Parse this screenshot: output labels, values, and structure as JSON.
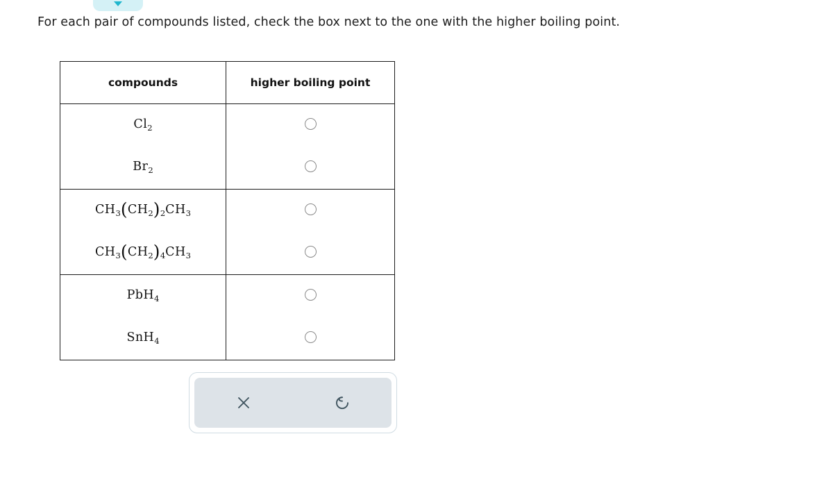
{
  "top_chip": {
    "icon": "chevron-down-icon",
    "background_color": "#d4f1f6",
    "chevron_color": "#1fb6cd"
  },
  "instruction": "For each pair of compounds listed, check the box next to the one with the higher boiling point.",
  "table": {
    "headers": {
      "compounds": "compounds",
      "higher_boiling_point": "higher boiling point"
    },
    "groups": [
      {
        "rows": [
          {
            "formula_plain": "Cl2",
            "parts": {
              "pre": "Cl",
              "pre_sub": "2"
            },
            "selected": false
          },
          {
            "formula_plain": "Br2",
            "parts": {
              "pre": "Br",
              "pre_sub": "2"
            },
            "selected": false
          }
        ]
      },
      {
        "rows": [
          {
            "formula_plain": "CH3(CH2)2CH3",
            "parts": {
              "pre": "CH",
              "pre_sub": "3",
              "group": "CH",
              "group_sub": "2",
              "rep": "2",
              "post": "CH",
              "post_sub": "3"
            },
            "selected": false
          },
          {
            "formula_plain": "CH3(CH2)4CH3",
            "parts": {
              "pre": "CH",
              "pre_sub": "3",
              "group": "CH",
              "group_sub": "2",
              "rep": "4",
              "post": "CH",
              "post_sub": "3"
            },
            "selected": false
          }
        ]
      },
      {
        "rows": [
          {
            "formula_plain": "PbH4",
            "parts": {
              "pre": "PbH",
              "pre_sub": "4"
            },
            "selected": false
          },
          {
            "formula_plain": "SnH4",
            "parts": {
              "pre": "SnH",
              "pre_sub": "4"
            },
            "selected": false
          }
        ]
      }
    ]
  },
  "toolbar": {
    "clear_label": "clear",
    "clear_icon": "close-x-icon",
    "reset_label": "reset",
    "reset_icon": "undo-reset-icon",
    "icon_color": "#3f545f",
    "panel_color": "#dde3e8"
  }
}
